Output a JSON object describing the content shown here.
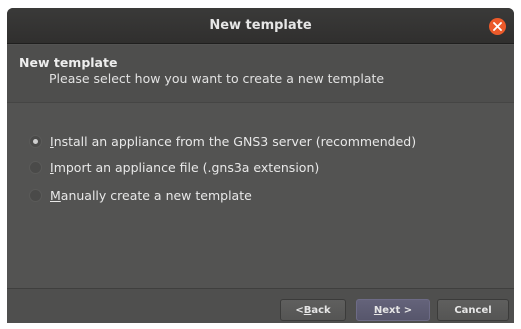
{
  "window": {
    "title": "New template",
    "close_icon": "close-icon"
  },
  "header": {
    "title": "New template",
    "subtitle": "Please select how you want to create a new template"
  },
  "options": [
    {
      "label_mnemonic": "I",
      "label_rest": "nstall an appliance from the GNS3 server (recommended)",
      "checked": true
    },
    {
      "label_mnemonic": "I",
      "label_rest": "mport an appliance file (.gns3a extension)",
      "checked": false
    },
    {
      "label_mnemonic": "M",
      "label_rest": "anually create a new template",
      "checked": false
    }
  ],
  "buttons": {
    "back": {
      "prefix": "< ",
      "mnemonic": "B",
      "rest": "ack"
    },
    "next": {
      "mnemonic": "N",
      "rest": "ext >"
    },
    "cancel": "Cancel"
  },
  "colors": {
    "close_button": "#ec5a2a",
    "window_bg": "#535352",
    "titlebar_bg": "#302f2e"
  }
}
